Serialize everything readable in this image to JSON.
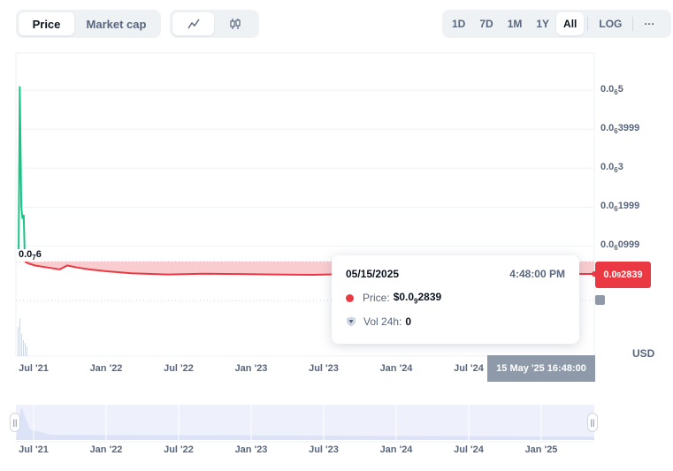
{
  "toolbar": {
    "type_tabs": [
      {
        "label": "Price",
        "active": true
      },
      {
        "label": "Market cap",
        "active": false
      }
    ],
    "style_tabs": [
      {
        "icon": "line-chart-icon",
        "active": true
      },
      {
        "icon": "candlestick-icon",
        "active": false
      }
    ],
    "ranges": [
      {
        "label": "1D",
        "active": false
      },
      {
        "label": "7D",
        "active": false
      },
      {
        "label": "1M",
        "active": false
      },
      {
        "label": "1Y",
        "active": false
      },
      {
        "label": "All",
        "active": true
      }
    ],
    "log_label": "LOG",
    "more_label": "···"
  },
  "chart_data": {
    "type": "line",
    "currency": "USD",
    "y_tick_labels": [
      {
        "prefix": "0.0",
        "zeros": "6",
        "digits": "5"
      },
      {
        "prefix": "0.0",
        "zeros": "6",
        "digits": "3999"
      },
      {
        "prefix": "0.0",
        "zeros": "6",
        "digits": "3"
      },
      {
        "prefix": "0.0",
        "zeros": "6",
        "digits": "1999"
      },
      {
        "prefix": "0.0",
        "zeros": "6",
        "digits": "0999"
      }
    ],
    "y_ticks": [
      5e-07,
      4e-07,
      3e-07,
      2e-07,
      1e-07
    ],
    "x_tick_labels": [
      "Jul '21",
      "Jan '22",
      "Jul '22",
      "Jan '23",
      "Jul '23",
      "Jan '24",
      "Jul '24",
      "Jan '25"
    ],
    "start_label": {
      "prefix": "0.0",
      "zeros": "7",
      "digits": "6"
    },
    "baseline_price": 6e-08,
    "series": [
      {
        "color_up": "#16c784",
        "color_down": "#ea3943",
        "points": [
          [
            "2021-05-20",
            6e-08
          ],
          [
            "2021-05-23",
            5.1e-07
          ],
          [
            "2021-05-27",
            2e-07
          ],
          [
            "2021-05-30",
            1.7e-07
          ],
          [
            "2021-06-02",
            1.8e-07
          ],
          [
            "2021-06-05",
            6e-08
          ],
          [
            "2021-06-15",
            5.5e-08
          ],
          [
            "2021-07-01",
            5e-08
          ],
          [
            "2021-08-01",
            4.5e-08
          ],
          [
            "2021-09-01",
            4e-08
          ],
          [
            "2021-09-20",
            5e-08
          ],
          [
            "2021-10-15",
            4.5e-08
          ],
          [
            "2021-11-15",
            4e-08
          ],
          [
            "2022-01-01",
            3.5e-08
          ],
          [
            "2022-03-01",
            3e-08
          ],
          [
            "2022-06-01",
            2.7e-08
          ],
          [
            "2022-09-01",
            2.9e-08
          ],
          [
            "2022-12-01",
            2.8e-08
          ],
          [
            "2023-03-01",
            2.7e-08
          ],
          [
            "2023-06-01",
            2.6e-08
          ],
          [
            "2023-09-01",
            2.8e-08
          ],
          [
            "2023-12-01",
            3e-08
          ],
          [
            "2024-03-01",
            2.8e-08
          ],
          [
            "2024-06-01",
            2.9e-08
          ],
          [
            "2024-09-01",
            2.8e-08
          ],
          [
            "2025-01-01",
            2.85e-08
          ],
          [
            "2025-05-15",
            2.839e-08
          ]
        ]
      }
    ],
    "grid": true,
    "log_scale": false
  },
  "tooltip": {
    "date": "05/15/2025",
    "time": "4:48:00 PM",
    "price_label": "Price:",
    "price_value": {
      "prefix": "$0.0",
      "zeros": "9",
      "digits": "2839"
    },
    "vol_label": "Vol 24h:",
    "vol_value": "0"
  },
  "current_price_tag": {
    "prefix": "0.0",
    "zeros": "9",
    "digits": "2839"
  },
  "crosshair_date": "15 May '25 16:48:00",
  "navigator": {
    "x_tick_labels": [
      "Jul '21",
      "Jan '22",
      "Jul '22",
      "Jan '23",
      "Jul '23",
      "Jan '24",
      "Jul '24",
      "Jan '25"
    ],
    "handle_glyph": "||"
  },
  "colors": {
    "up": "#16c784",
    "down": "#ea3943",
    "fill": "#f8c7ca",
    "accent": "#3861fb"
  }
}
